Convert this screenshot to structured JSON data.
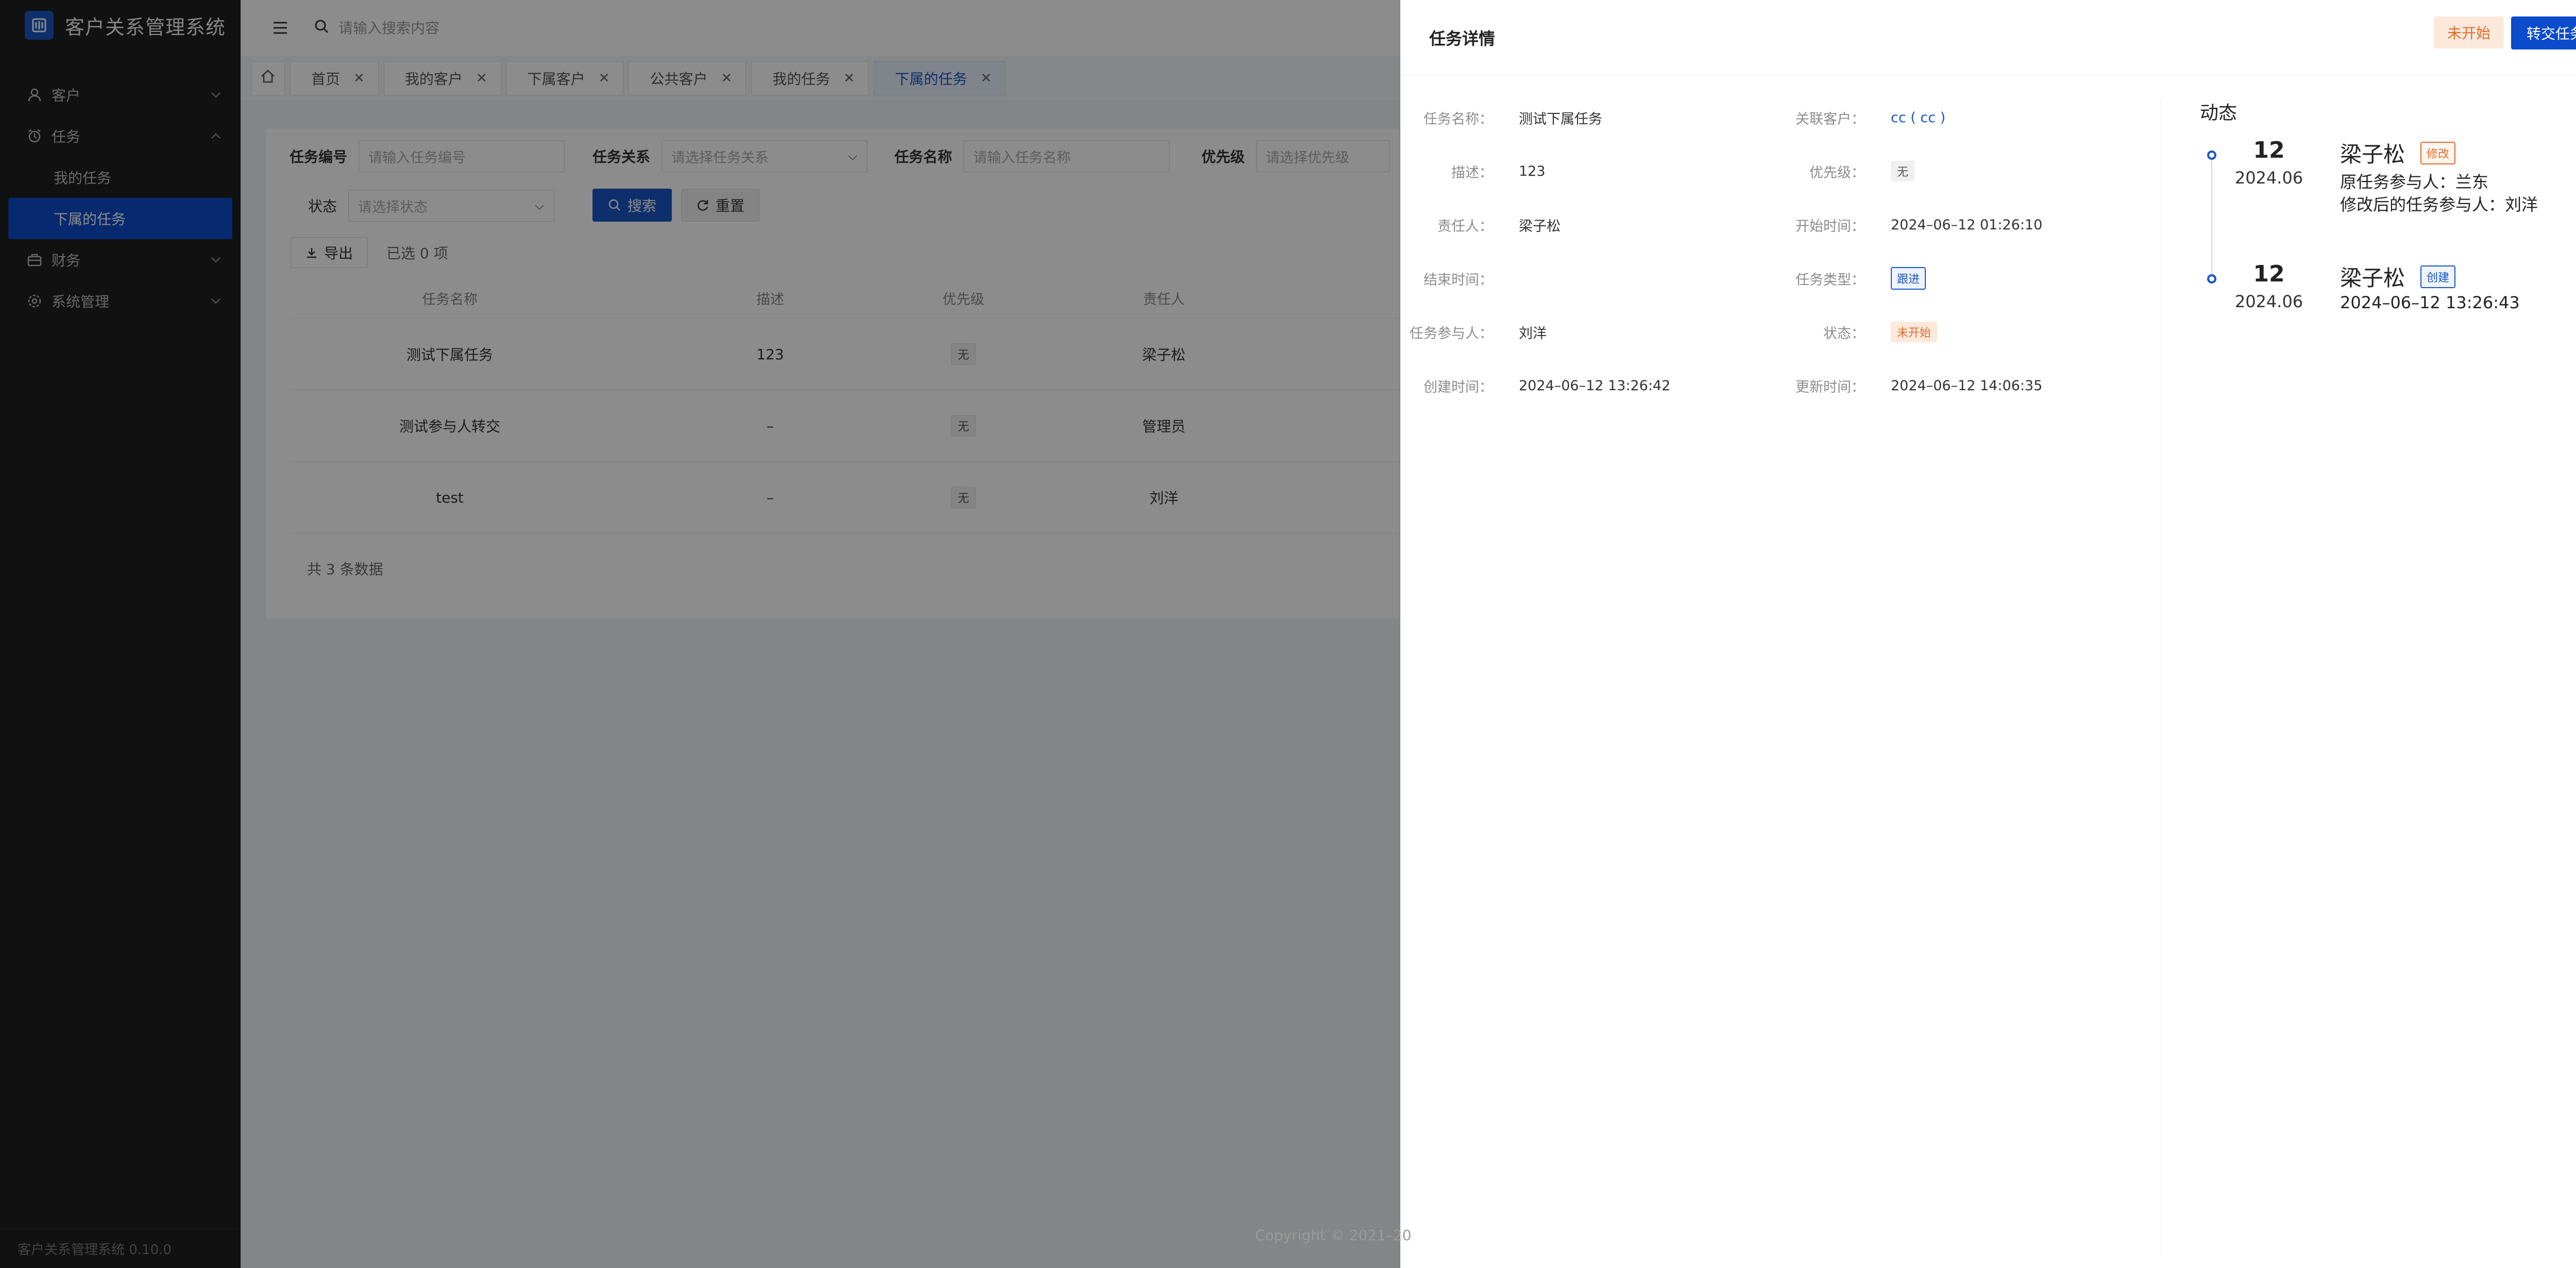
{
  "app": {
    "title": "客户关系管理系统",
    "version_text": "客户关系管理系统 0.10.0"
  },
  "colors": {
    "primary": "#1a56c4",
    "sidebar_bg": "#1f1f1f",
    "status_orange": "#e06b2c"
  },
  "sidebar": {
    "items": [
      {
        "label": "客户",
        "icon": "user-icon",
        "expanded": false
      },
      {
        "label": "任务",
        "icon": "alarm-clock-icon",
        "expanded": true,
        "children": [
          {
            "label": "我的任务"
          },
          {
            "label": "下属的任务",
            "active": true
          }
        ]
      },
      {
        "label": "财务",
        "icon": "finance-icon",
        "expanded": false
      },
      {
        "label": "系统管理",
        "icon": "gear-icon",
        "expanded": false
      }
    ]
  },
  "header": {
    "search_placeholder": "请输入搜索内容"
  },
  "tabs": [
    {
      "label": "首页"
    },
    {
      "label": "我的客户"
    },
    {
      "label": "下属客户"
    },
    {
      "label": "公共客户"
    },
    {
      "label": "我的任务"
    },
    {
      "label": "下属的任务",
      "active": true
    }
  ],
  "filters": {
    "task_no": {
      "label": "任务编号",
      "placeholder": "请输入任务编号"
    },
    "relation": {
      "label": "任务关系",
      "placeholder": "请选择任务关系"
    },
    "task_name": {
      "label": "任务名称",
      "placeholder": "请输入任务名称"
    },
    "priority": {
      "label": "优先级",
      "placeholder": "请选择优先级"
    },
    "status": {
      "label": "状态",
      "placeholder": "请选择状态"
    },
    "search_label": "搜索",
    "reset_label": "重置",
    "export_label": "导出",
    "selected_text": "已选 0 项"
  },
  "table": {
    "columns": [
      "任务名称",
      "描述",
      "优先级",
      "责任人"
    ],
    "rows": [
      {
        "name": "测试下属任务",
        "desc": "123",
        "priority": "无",
        "owner": "梁子松"
      },
      {
        "name": "测试参与人转交",
        "desc": "–",
        "priority": "无",
        "owner": "管理员"
      },
      {
        "name": "test",
        "desc": "–",
        "priority": "无",
        "owner": "刘洋"
      }
    ],
    "total_text": "共 3 条数据"
  },
  "copyright": "Copyright © 2021–20",
  "drawer": {
    "title": "任务详情",
    "status_button": "未开始",
    "transfer_button": "转交任务",
    "close": "×",
    "fields": {
      "task_name": {
        "label": "任务名称：",
        "value": "测试下属任务"
      },
      "customer": {
        "label": "关联客户：",
        "value": "cc ( cc )"
      },
      "desc": {
        "label": "描述：",
        "value": "123"
      },
      "priority": {
        "label": "优先级：",
        "value": "无"
      },
      "owner": {
        "label": "责任人：",
        "value": "梁子松"
      },
      "start_time": {
        "label": "开始时间：",
        "value": "2024–06–12 01:26:10"
      },
      "end_time": {
        "label": "结束时间：",
        "value": ""
      },
      "task_type": {
        "label": "任务类型：",
        "value": "跟进"
      },
      "participant": {
        "label": "任务参与人：",
        "value": "刘洋"
      },
      "status": {
        "label": "状态：",
        "value": "未开始"
      },
      "created": {
        "label": "创建时间：",
        "value": "2024–06–12 13:26:42"
      },
      "updated": {
        "label": "更新时间：",
        "value": "2024–06–12 14:06:35"
      }
    },
    "activity": {
      "title": "动态",
      "items": [
        {
          "day": "12",
          "ym": "2024.06",
          "user": "梁子松",
          "tag": "修改",
          "line1": "原任务参与人：兰东",
          "line2": "修改后的任务参与人：刘洋"
        },
        {
          "day": "12",
          "ym": "2024.06",
          "user": "梁子松",
          "tag": "创建",
          "line1": "2024–06–12 13:26:43"
        }
      ]
    }
  }
}
